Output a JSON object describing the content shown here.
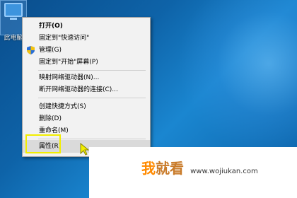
{
  "desktop": {
    "icon_label": "此电脑"
  },
  "context_menu": {
    "items": [
      {
        "label": "打开(O)",
        "bold": true
      },
      {
        "label": "固定到\"快速访问\""
      },
      {
        "label": "管理(G)",
        "icon": "shield-icon"
      },
      {
        "label": "固定到\"开始\"屏幕(P)"
      },
      {
        "label": "映射网络驱动器(N)..."
      },
      {
        "label": "断开网络驱动器的连接(C)..."
      },
      {
        "label": "创建快捷方式(S)"
      },
      {
        "label": "删除(D)"
      },
      {
        "label": "重命名(M)"
      },
      {
        "label": "属性(R)",
        "highlighted": true
      }
    ]
  },
  "watermark": {
    "text_1": "我",
    "text_2": "就看",
    "url": "www.wojiukan.com"
  },
  "colors": {
    "highlight_border": "#f2ee00",
    "menu_bg": "#f2f2f2",
    "watermark_orange": "#ff8a00"
  }
}
